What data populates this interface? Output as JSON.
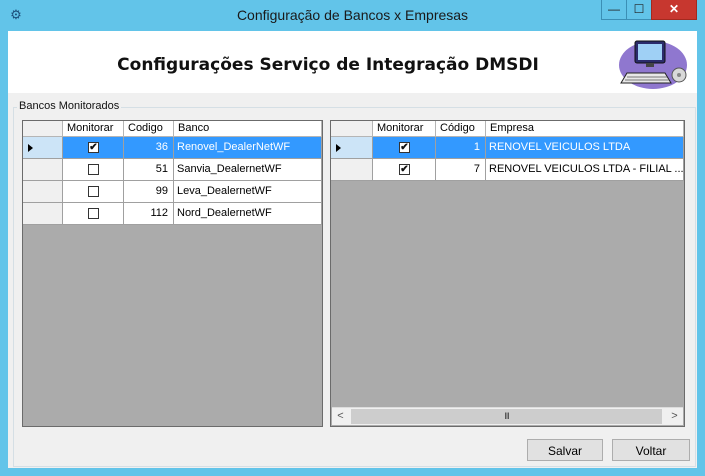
{
  "window": {
    "title": "Configuração de Bancos x Empresas",
    "app_icon": "gear-icon"
  },
  "controls": {
    "minimize": "—",
    "maximize": "☐",
    "close": "✕"
  },
  "header": {
    "title": "Configurações Serviço de Integração DMSDI"
  },
  "group": {
    "label": "Bancos Monitorados"
  },
  "bancos": {
    "columns": [
      "Monitorar",
      "Codigo",
      "Banco"
    ],
    "rows": [
      {
        "monitorar": true,
        "codigo": "36",
        "banco": "Renovel_DealerNetWF",
        "selected": true
      },
      {
        "monitorar": false,
        "codigo": "51",
        "banco": "Sanvia_DealernetWF",
        "selected": false
      },
      {
        "monitorar": false,
        "codigo": "99",
        "banco": "Leva_DealernetWF",
        "selected": false
      },
      {
        "monitorar": false,
        "codigo": "112",
        "banco": "Nord_DealernetWF",
        "selected": false
      }
    ]
  },
  "empresas": {
    "columns": [
      "Monitorar",
      "Código",
      "Empresa"
    ],
    "rows": [
      {
        "monitorar": true,
        "codigo": "1",
        "empresa": "RENOVEL VEICULOS LTDA",
        "selected": true
      },
      {
        "monitorar": true,
        "codigo": "7",
        "empresa": "RENOVEL VEICULOS LTDA - FILIAL ...",
        "selected": false
      }
    ],
    "scroll_left": "<",
    "scroll_right": ">",
    "scroll_thumb": "III"
  },
  "buttons": {
    "salvar": "Salvar",
    "voltar": "Voltar"
  },
  "checkmark": "✔"
}
